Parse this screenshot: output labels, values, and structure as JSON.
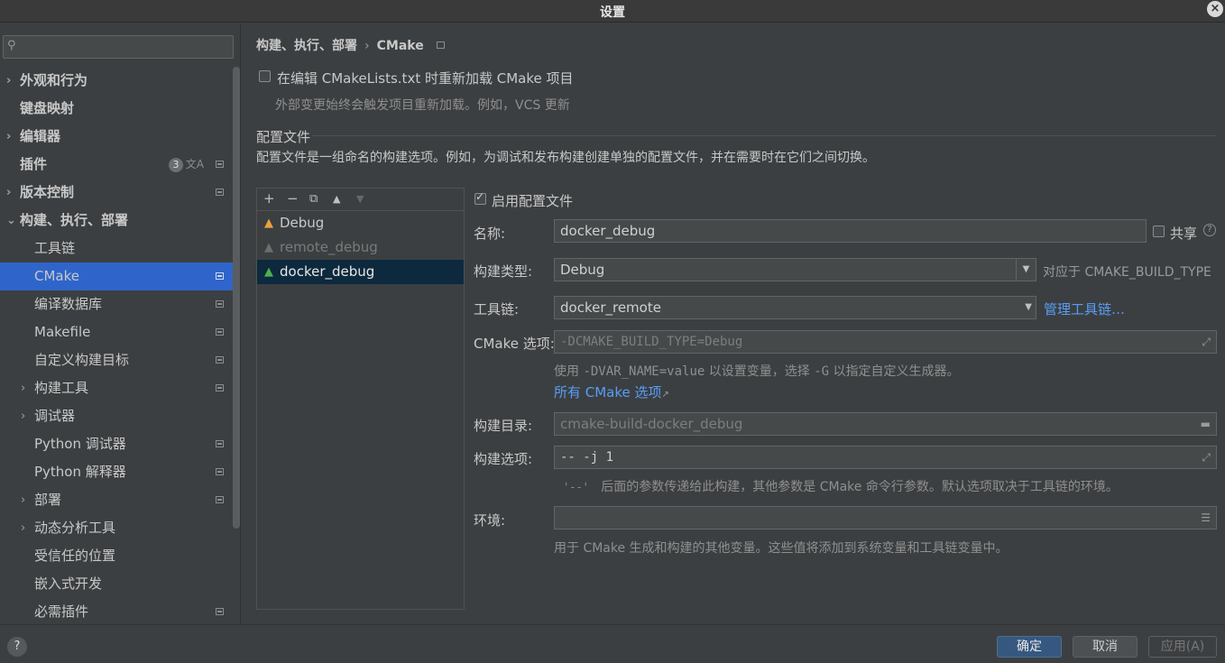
{
  "window": {
    "title": "设置",
    "close": "×"
  },
  "search": {
    "placeholder": ""
  },
  "sidebar": {
    "items": [
      {
        "label": "外观和行为",
        "arrow": "›"
      },
      {
        "label": "键盘映射"
      },
      {
        "label": "编辑器",
        "arrow": "›"
      },
      {
        "label": "插件",
        "badge": "3",
        "extra": "文A"
      },
      {
        "label": "版本控制",
        "arrow": "›"
      },
      {
        "label": "构建、执行、部署",
        "arrow": "⌄"
      },
      {
        "label": "工具链"
      },
      {
        "label": "CMake"
      },
      {
        "label": "编译数据库"
      },
      {
        "label": "Makefile"
      },
      {
        "label": "自定义构建目标"
      },
      {
        "label": "构建工具",
        "arrow": "›"
      },
      {
        "label": "调试器",
        "arrow": "›"
      },
      {
        "label": "Python 调试器"
      },
      {
        "label": "Python 解释器"
      },
      {
        "label": "部署",
        "arrow": "›"
      },
      {
        "label": "动态分析工具",
        "arrow": "›"
      },
      {
        "label": "受信任的位置"
      },
      {
        "label": "嵌入式开发"
      },
      {
        "label": "必需插件"
      }
    ]
  },
  "breadcrumb": {
    "parent": "构建、执行、部署",
    "sep": "›",
    "current": "CMake"
  },
  "reload": {
    "label": "在编辑 CMakeLists.txt 时重新加载 CMake 项目",
    "hint": "外部变更始终会触发项目重新加载。例如，VCS 更新"
  },
  "profiles_section": {
    "title": "配置文件",
    "desc": "配置文件是一组命名的构建选项。例如，为调试和发布构建创建单独的配置文件，并在需要时在它们之间切换。"
  },
  "toolbar": {
    "add": "+",
    "remove": "−",
    "copy": "⧉",
    "up": "▲",
    "down": "▼"
  },
  "profiles": [
    {
      "name": "Debug"
    },
    {
      "name": "remote_debug"
    },
    {
      "name": "docker_debug"
    }
  ],
  "form": {
    "enable_label": "启用配置文件",
    "name_label": "名称:",
    "name_value": "docker_debug",
    "share_label": "共享",
    "share_help": "?",
    "build_type_label": "构建类型:",
    "build_type_value": "Debug",
    "build_type_hint": "对应于 CMAKE_BUILD_TYPE",
    "toolchain_label": "工具链:",
    "toolchain_value": "docker_remote",
    "manage_toolchains": "管理工具链…",
    "cmake_options_label": "CMake 选项:",
    "cmake_options_value": "-DCMAKE_BUILD_TYPE=Debug",
    "cmake_hint_1": "使用",
    "cmake_hint_code1": "-DVAR_NAME=value",
    "cmake_hint_2": "以设置变量，选择",
    "cmake_hint_code2": "-G",
    "cmake_hint_3": "以指定自定义生成器。",
    "all_options_link": "所有 CMake 选项",
    "all_options_arrow": "↗",
    "build_dir_label": "构建目录:",
    "build_dir_value": "cmake-build-docker_debug",
    "build_options_label": "构建选项:",
    "build_options_value": "-- -j 1",
    "build_options_hint_code": "'--'",
    "build_options_hint": "后面的参数传递给此构建，其他参数是 CMake 命令行参数。默认选项取决于工具链的环境。",
    "env_label": "环境:",
    "env_value": "",
    "env_hint": "用于 CMake 生成和构建的其他变量。这些值将添加到系统变量和工具链变量中。"
  },
  "buttons": {
    "help": "?",
    "ok": "确定",
    "cancel": "取消",
    "apply": "应用(A)"
  },
  "colors": {
    "accent": "#2f65ca",
    "link": "#589df6",
    "primary_button": "#365880"
  }
}
